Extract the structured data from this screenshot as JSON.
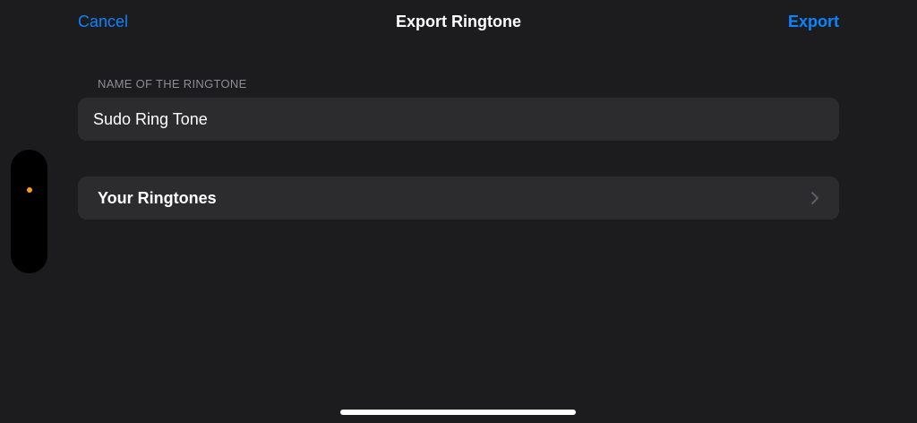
{
  "nav": {
    "cancel_label": "Cancel",
    "title": "Export Ringtone",
    "export_label": "Export"
  },
  "form": {
    "name_section_header": "NAME OF THE RINGTONE",
    "name_value": "Sudo Ring Tone",
    "your_ringtones_label": "Your Ringtones"
  },
  "icons": {
    "row_chevron": "chevron-right-icon",
    "indicator_dot": "orange-dot-icon"
  },
  "colors": {
    "background": "#1c1c1e",
    "cell_background": "#2c2c2e",
    "accent": "#0a84ff",
    "secondary_text": "#8e8e93",
    "indicator_dot": "#ff9f0a"
  }
}
